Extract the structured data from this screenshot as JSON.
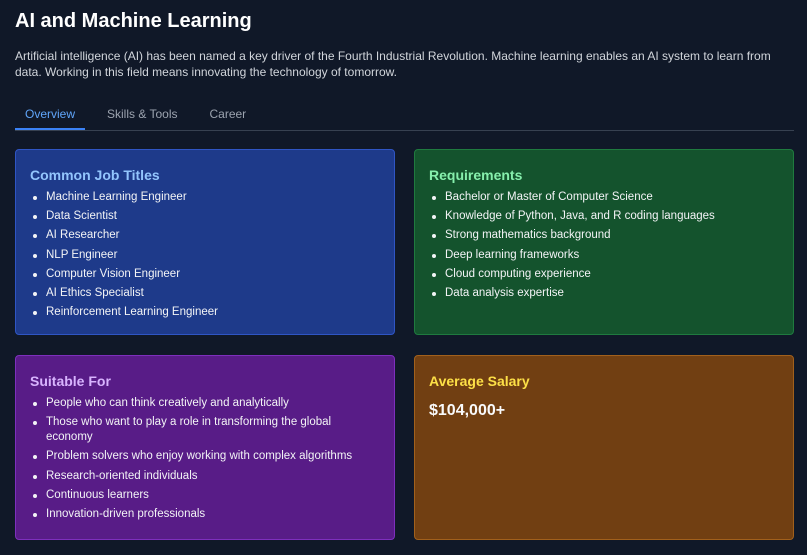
{
  "header": {
    "title": "AI and Machine Learning",
    "description": "Artificial intelligence (AI) has been named a key driver of the Fourth Industrial Revolution. Machine learning enables an AI system to learn from data. Working in this field means innovating the technology of tomorrow."
  },
  "tabs": [
    {
      "label": "Overview",
      "active": true
    },
    {
      "label": "Skills & Tools",
      "active": false
    },
    {
      "label": "Career",
      "active": false
    }
  ],
  "cards": {
    "jobs": {
      "title": "Common Job Titles",
      "items": [
        "Machine Learning Engineer",
        "Data Scientist",
        "AI Researcher",
        "NLP Engineer",
        "Computer Vision Engineer",
        "AI Ethics Specialist",
        "Reinforcement Learning Engineer"
      ]
    },
    "requirements": {
      "title": "Requirements",
      "items": [
        "Bachelor or Master of Computer Science",
        "Knowledge of Python, Java, and R coding languages",
        "Strong mathematics background",
        "Deep learning frameworks",
        "Cloud computing experience",
        "Data analysis expertise"
      ]
    },
    "suitable": {
      "title": "Suitable For",
      "items": [
        "People who can think creatively and analytically",
        "Those who want to play a role in transforming the global economy",
        "Problem solvers who enjoy working with complex algorithms",
        "Research-oriented individuals",
        "Continuous learners",
        "Innovation-driven professionals"
      ]
    },
    "salary": {
      "title": "Average Salary",
      "value": "$104,000+"
    }
  },
  "colors": {
    "background": "#101828",
    "tab_active": "#60a5fa",
    "jobs_bg": "#1e3a8a",
    "requirements_bg": "#14532d",
    "suitable_bg": "#581c87",
    "salary_bg": "#713f12"
  }
}
